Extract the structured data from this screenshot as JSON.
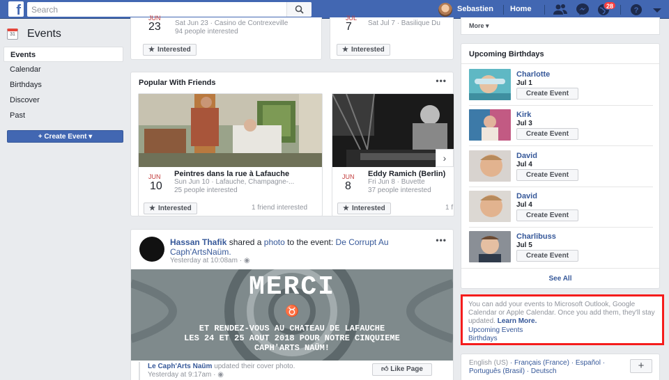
{
  "topbar": {
    "search_placeholder": "Search",
    "user_name": "Sebastien",
    "home_label": "Home",
    "notification_count": "28"
  },
  "sidebar": {
    "calendar_icon_day": "31",
    "title": "Events",
    "items": [
      {
        "label": "Events",
        "active": true
      },
      {
        "label": "Calendar"
      },
      {
        "label": "Birthdays"
      },
      {
        "label": "Discover"
      },
      {
        "label": "Past"
      }
    ],
    "create_event_label": "Create Event"
  },
  "upcoming_events": [
    {
      "month": "JUN",
      "day": "23",
      "line1": "Sat Jun 23 · Casino de Contrexeville",
      "line2": "94 people interested",
      "button": "Interested"
    },
    {
      "month": "JUL",
      "day": "7",
      "line1": "Sat Jul 7 · Basilique Du",
      "line2": "",
      "button": "Interested"
    }
  ],
  "popular": {
    "title": "Popular With Friends",
    "events": [
      {
        "month": "JUN",
        "day": "10",
        "name": "Peintres dans la rue à Lafauche",
        "line1": "Sun Jun 10 · Lafauche, Champagne-...",
        "line2": "25 people interested",
        "button": "Interested",
        "friends": "1 friend interested"
      },
      {
        "month": "JUN",
        "day": "8",
        "name": "Eddy Ramich (Berlin)",
        "line1": "Fri Jun 8 · Buvette",
        "line2": "37 people interested",
        "button": "Interested",
        "friends": "1 f"
      }
    ]
  },
  "post": {
    "author": "Hassan Thafik",
    "text_shared": "shared a",
    "text_photo": "photo",
    "text_to_event": "to the event:",
    "event_name": "De Corrupt Au Caph'ArtsNaüm.",
    "time": "Yesterday at 10:08am ·",
    "image_title": "MERCI",
    "image_symbol": "♉",
    "image_lines": [
      "ET RENDEZ-VOUS AU CHATEAU DE LAFAUCHE",
      "LES 24 ET 25 AOUT 2018 POUR NOTRE CINQUIEME",
      "CAPH'ARTS NAÜM!"
    ],
    "sub_author": "Le Caph'Arts Naüm",
    "sub_action": "updated their cover photo.",
    "sub_time": "Yesterday at 9:17am ·",
    "like_page_label": "Like Page"
  },
  "right": {
    "more_label": "More",
    "birthdays_title": "Upcoming Birthdays",
    "birthdays": [
      {
        "name": "Charlotte",
        "date": "Jul 1",
        "button": "Create Event"
      },
      {
        "name": "Kirk",
        "date": "Jul 3",
        "button": "Create Event"
      },
      {
        "name": "David",
        "date": "Jul 4",
        "button": "Create Event"
      },
      {
        "name": "David",
        "date": "Jul 4",
        "button": "Create Event"
      },
      {
        "name": "Charlibuss",
        "date": "Jul 5",
        "button": "Create Event"
      }
    ],
    "see_all": "See All",
    "export_text": "You can add your events to Microsoft Outlook, Google Calendar or Apple Calendar. Once you add them, they'll stay updated.",
    "learn_more": "Learn More.",
    "upcoming_events_link": "Upcoming Events",
    "birthdays_link": "Birthdays",
    "languages": {
      "current": "English (US)",
      "others": [
        "Français (France)",
        "Español",
        "Português (Brasil)",
        "Deutsch"
      ]
    },
    "add_language": "+"
  },
  "colors": {
    "brand": "#4267b2",
    "link": "#365899",
    "highlight_border": "#f51c1c",
    "badge": "#fa3e3e"
  }
}
